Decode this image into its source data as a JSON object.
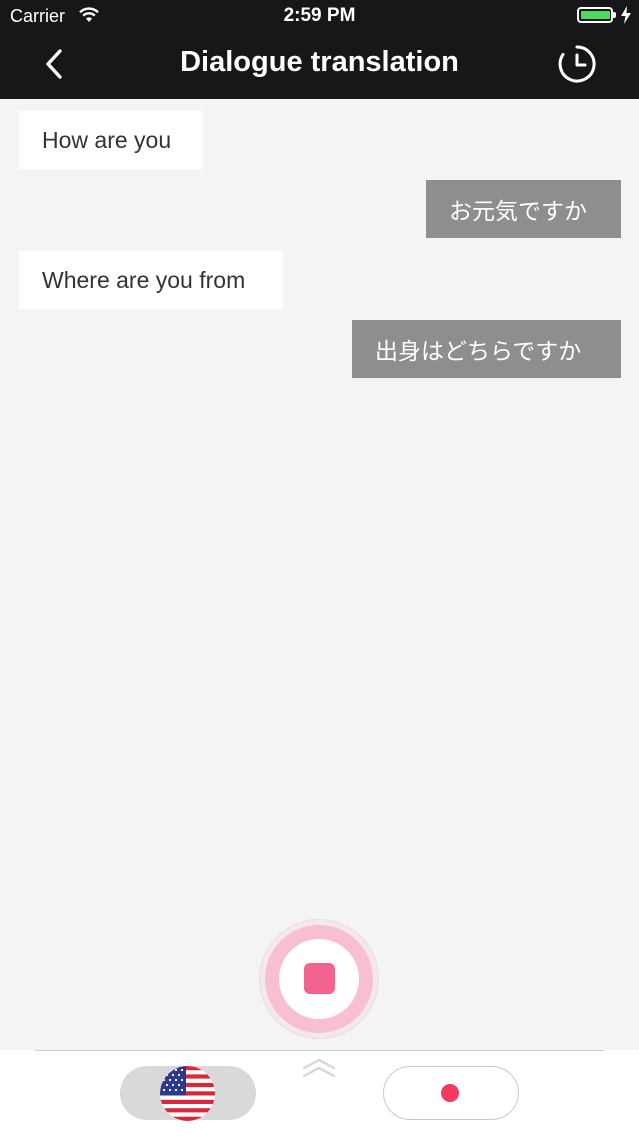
{
  "status_bar": {
    "carrier": "Carrier",
    "time": "2:59 PM",
    "icons": [
      "wifi-icon",
      "battery-icon",
      "charging-bolt-icon"
    ],
    "battery_color": "#4cd964"
  },
  "nav": {
    "title": "Dialogue translation",
    "back_icon": "chevron-left-icon",
    "history_icon": "history-clock-icon"
  },
  "messages": [
    {
      "side": "left",
      "text": "How are you"
    },
    {
      "side": "right",
      "text": "お元気ですか"
    },
    {
      "side": "left",
      "text": "Where are you from"
    },
    {
      "side": "right",
      "text": "出身はどちらですか"
    }
  ],
  "record": {
    "icon": "stop-icon",
    "accent_color": "#f2638f"
  },
  "bottom_bar": {
    "expand_icon": "double-chevron-up-icon",
    "left_language_icon": "us-flag-icon",
    "right_record_icon": "record-dot-icon",
    "record_dot_color": "#f23a5c"
  }
}
